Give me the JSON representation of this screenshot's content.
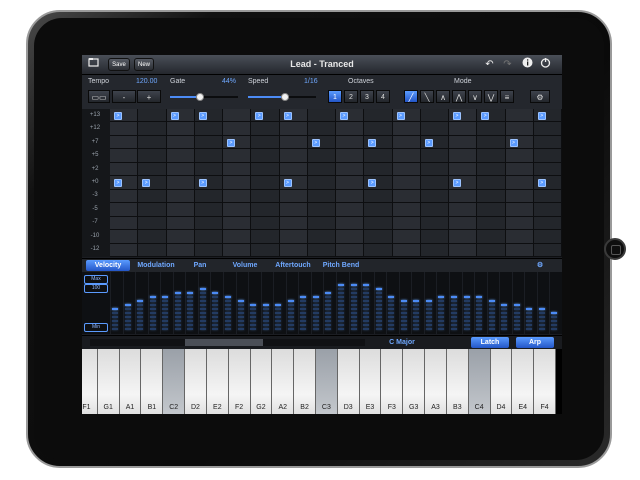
{
  "window": {
    "title": "Lead - Tranced"
  },
  "toolbar": {
    "save_label": "Save",
    "new_label": "New",
    "icons": [
      "folder-icon",
      "undo-icon",
      "redo-icon",
      "info-icon",
      "power-icon"
    ]
  },
  "controls": {
    "tempo_label": "Tempo",
    "tempo_value": "120.00",
    "gate_label": "Gate",
    "gate_value": "44%",
    "gate_fraction": 0.44,
    "speed_label": "Speed",
    "speed_value": "1/16",
    "speed_fraction": 0.55,
    "octaves_label": "Octaves",
    "octaves": [
      "1",
      "2",
      "3",
      "4"
    ],
    "octave_selected": "1",
    "mode_label": "Mode",
    "minus_label": "-",
    "plus_label": "+",
    "tap_label": "▭▭"
  },
  "grid": {
    "rows": [
      "+13",
      "+12",
      "+7",
      "+5",
      "+2",
      "+0",
      "-3",
      "-5",
      "-7",
      "-10",
      "-12"
    ],
    "note_symbol": ">"
  },
  "params": {
    "tabs": [
      "Velocity",
      "Modulation",
      "Pan",
      "Volume",
      "Aftertouch",
      "Pitch Bend"
    ],
    "active": "Velocity",
    "max_label": "Max",
    "val_label": "100",
    "min_label": "Min"
  },
  "velocity_levels": [
    0.45,
    0.5,
    0.55,
    0.6,
    0.65,
    0.7,
    0.72,
    0.74,
    0.7,
    0.62,
    0.55,
    0.5,
    0.48,
    0.5,
    0.55,
    0.6,
    0.66,
    0.72,
    0.8,
    0.84,
    0.82,
    0.74,
    0.65,
    0.58,
    0.55,
    0.58,
    0.62,
    0.66,
    0.64,
    0.6,
    0.56,
    0.52,
    0.48,
    0.44,
    0.4,
    0.38
  ],
  "keyboard_bar": {
    "scale": "C Major",
    "latch_label": "Latch",
    "arp_label": "Arp"
  },
  "keys": [
    "F1",
    "G1",
    "A1",
    "B1",
    "C2",
    "D2",
    "E2",
    "F2",
    "G2",
    "A2",
    "B2",
    "C3",
    "D3",
    "E3",
    "F3",
    "G3",
    "A3",
    "B3",
    "C4",
    "D4",
    "E4",
    "F4"
  ],
  "highlighted_keys": [
    "C2",
    "C3",
    "C4"
  ]
}
